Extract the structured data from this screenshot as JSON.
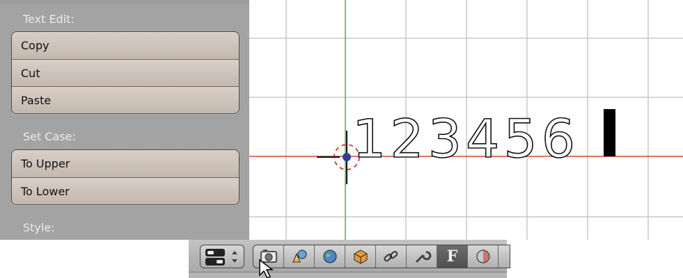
{
  "panel": {
    "sections": [
      {
        "label": "Text Edit:",
        "buttons": [
          "Copy",
          "Cut",
          "Paste"
        ]
      },
      {
        "label": "Set Case:",
        "buttons": [
          "To Upper",
          "To Lower"
        ]
      },
      {
        "label": "Style:",
        "buttons": []
      }
    ]
  },
  "viewport": {
    "text_object": "123456"
  },
  "properties_header": {
    "editor_type_icon": "editor-type-icon",
    "tabs": [
      {
        "icon": "render-icon"
      },
      {
        "icon": "scene-icon"
      },
      {
        "icon": "world-icon"
      },
      {
        "icon": "object-icon"
      },
      {
        "icon": "constraints-icon"
      },
      {
        "icon": "modifiers-icon"
      },
      {
        "icon": "font-data-icon",
        "letter": "F",
        "active": true
      },
      {
        "icon": "material-icon"
      }
    ]
  },
  "colors": {
    "panel_bg": "#a3a3a3",
    "button_bg": "#d2c8bf",
    "x_axis": "#d0392b",
    "y_axis": "#6ab04c",
    "grid": "#c8c8c8",
    "active_tab": "#5c5c5c"
  }
}
